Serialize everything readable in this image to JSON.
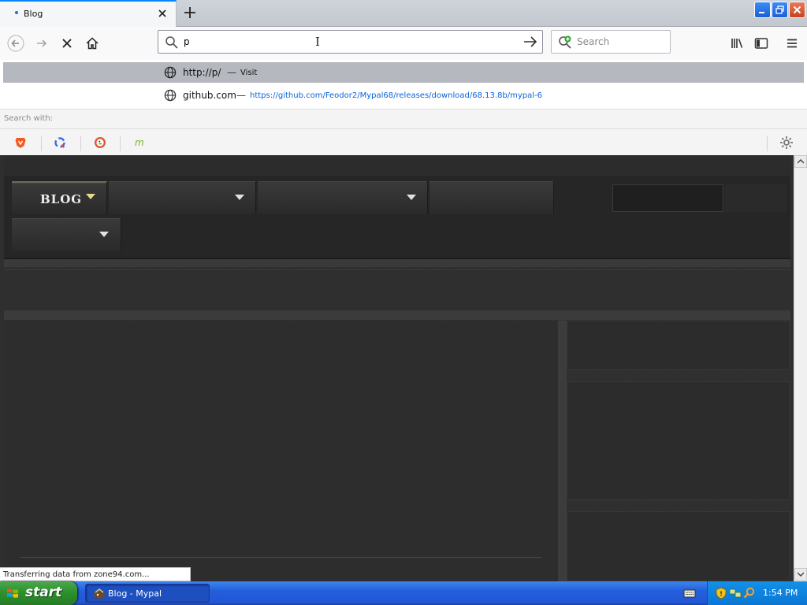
{
  "browser": {
    "tab": {
      "title": "Blog"
    },
    "urlbar": {
      "value": "p"
    },
    "searchbar": {
      "placeholder": "Search"
    }
  },
  "dropdown": {
    "suggestions": [
      {
        "url_display": "http://p/",
        "separator": "—",
        "action": "Visit"
      },
      {
        "title": "github.com",
        "separator": "—",
        "url": "https://github.com/Feodor2/Mypal68/releases/download/68.13.8b/mypal-6"
      }
    ],
    "search_with_label": "Search with:",
    "engines": [
      "brave-icon",
      "qwant-icon",
      "duckduckgo-icon",
      "mojeek-icon"
    ]
  },
  "page": {
    "menu": {
      "blog_label": "BLOG"
    }
  },
  "status": {
    "text": "Transferring data from zone94.com..."
  },
  "taskbar": {
    "start_label": "start",
    "window_label": "Blog - Mypal",
    "clock": "1:54 PM"
  },
  "colors": {
    "accent": "#0a84ff",
    "taskbar": "#245edb",
    "start": "#2c8f2c"
  }
}
